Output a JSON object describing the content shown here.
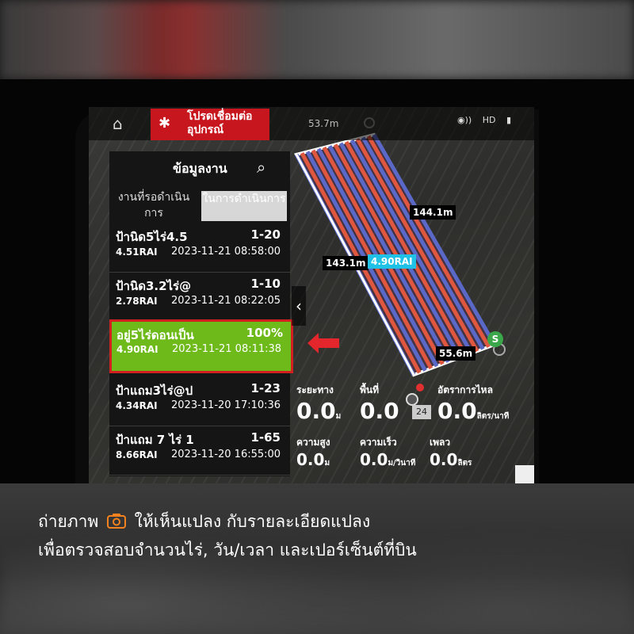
{
  "topbar": {
    "alert_text": "โปรดเชื่อมต่อ\nอุปกรณ์",
    "altitude_top": "53.7m",
    "status_hd": "HD"
  },
  "panel": {
    "title": "ข้อมูลงาน",
    "tab_pending": "งานที่รอดำเนินการ",
    "tab_in_progress": "ในการดำเนินการ",
    "tasks": [
      {
        "name": "ป้านิด5ไร่4.5",
        "code": "1-20",
        "area": "4.51RAI",
        "date": "2023-11-21 08:58:00"
      },
      {
        "name": "ป้านิด3.2ไร่@",
        "code": "1-10",
        "area": "2.78RAI",
        "date": "2023-11-21 08:22:05"
      },
      {
        "name": "อยู่5ไร่ดอนเป็น",
        "code": "100%",
        "area": "4.90RAI",
        "date": "2023-11-21 08:11:38"
      },
      {
        "name": "ป้าแถม3ไร่@ป",
        "code": "1-23",
        "area": "4.34RAI",
        "date": "2023-11-20 17:10:36"
      },
      {
        "name": "ป้าแถม 7 ไร่ 1",
        "code": "1-65",
        "area": "8.66RAI",
        "date": "2023-11-20 16:55:00"
      }
    ]
  },
  "map": {
    "dim_top": "144.1m",
    "dim_left": "143.1m",
    "area_label": "4.90RAI",
    "dim_right": "55.6m",
    "s_marker": "S",
    "point_num": "24"
  },
  "telemetry": {
    "distance_label": "ระยะทาง",
    "distance_value": "0.0",
    "distance_unit": "ม",
    "area_label": "พื้นที่",
    "area_value": "0.0",
    "flow_label": "อัตราการไหล",
    "flow_value": "0.0",
    "flow_unit": "ลิตร/นาที",
    "height_label": "ความสูง",
    "height_value": "0.0",
    "height_unit": "ม",
    "speed_label": "ความเร็ว",
    "speed_value": "0.0",
    "speed_unit": "ม/วินาที",
    "spray_label": "เพลว",
    "spray_value": "0.0",
    "spray_unit": "ลิตร"
  },
  "caption": {
    "line1_a": "ถ่ายภาพ",
    "line1_b": "ให้เห็นแปลง กับรายละเอียดแปลง",
    "line2": "เพื่อตรวจสอบจำนวนไร่, วัน/เวลา และเปอร์เซ็นต์ที่บิน",
    "accent": "#f5821f",
    "icon": "camera-icon"
  }
}
